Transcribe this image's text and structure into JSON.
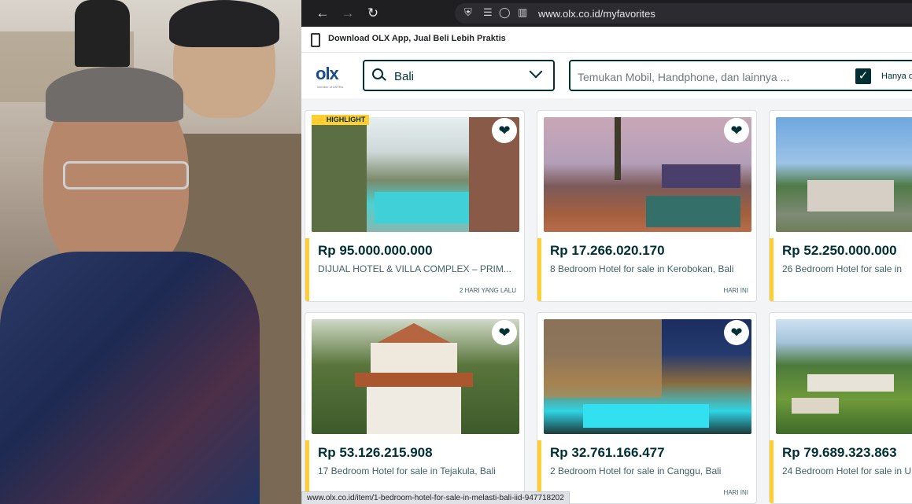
{
  "browser": {
    "url": "www.olx.co.id/myfavorites",
    "back_icon": "arrow-left-icon",
    "forward_icon": "arrow-right-icon",
    "reload_icon": "reload-icon",
    "status_url": "www.olx.co.id/item/1-bedroom-hotel-for-sale-in-melasti-bali-iid-947718202"
  },
  "banner": {
    "text": "Download OLX App, Jual Beli Lebih Praktis"
  },
  "header": {
    "logo": "olx",
    "logo_sub": "member of ASTRA",
    "location_value": "Bali",
    "search_placeholder": "Temukan Mobil, Handphone, dan lainnya ...",
    "filter_label": "Hanya di",
    "filter_checked": true
  },
  "listings": [
    {
      "price": "Rp 95.000.000.000",
      "title": "DIJUAL HOTEL & VILLA COMPLEX – PRIM...",
      "date": "2 HARI YANG LALU",
      "badge": "HIGHLIGHT",
      "favorited": true
    },
    {
      "price": "Rp 17.266.020.170",
      "title": "8 Bedroom Hotel for sale in Kerobokan, Bali",
      "date": "HARI INI",
      "badge": "",
      "favorited": true
    },
    {
      "price": "Rp 52.250.000.000",
      "title": "26 Bedroom Hotel for sale in",
      "date": "",
      "badge": "",
      "favorited": true
    },
    {
      "price": "Rp 53.126.215.908",
      "title": "17 Bedroom Hotel for sale in Tejakula, Bali",
      "date": "",
      "badge": "",
      "favorited": true
    },
    {
      "price": "Rp 32.761.166.477",
      "title": "2 Bedroom Hotel for sale in Canggu, Bali",
      "date": "HARI INI",
      "badge": "",
      "favorited": true
    },
    {
      "price": "Rp 79.689.323.863",
      "title": "24 Bedroom Hotel for sale in U",
      "date": "",
      "badge": "",
      "favorited": true
    }
  ],
  "colors": {
    "brand": "#002f34",
    "highlight": "#ffce32"
  }
}
